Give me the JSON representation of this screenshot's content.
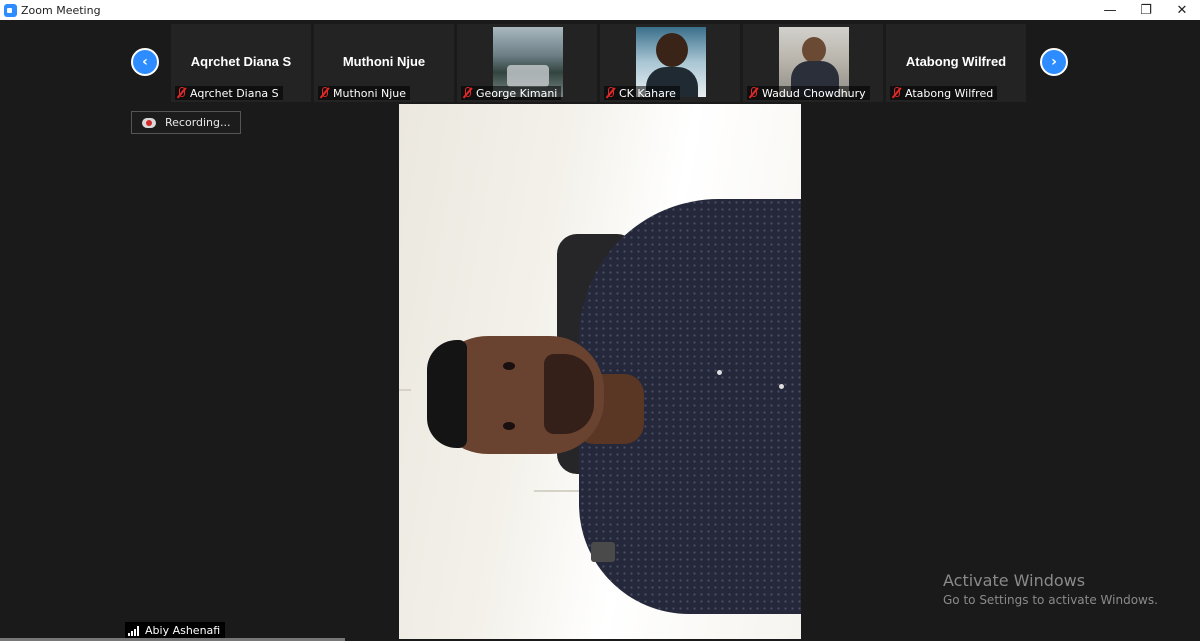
{
  "window": {
    "title": "Zoom Meeting",
    "controls": {
      "minimize": "—",
      "restore": "❐",
      "close": "✕"
    }
  },
  "strip": {
    "prev_icon": "chevron-left-icon",
    "next_icon": "chevron-right-icon",
    "participants": [
      {
        "display_name": "Aqrchet Diana S",
        "label": "Aqrchet Diana S",
        "muted": true,
        "video": false
      },
      {
        "display_name": "Muthoni Njue",
        "label": "Muthoni Njue",
        "muted": true,
        "video": false
      },
      {
        "label": "George Kimani",
        "muted": true,
        "video": true
      },
      {
        "label": "CK Kahare",
        "muted": true,
        "video": true
      },
      {
        "label": "Wadud Chowdhury",
        "muted": true,
        "video": true
      },
      {
        "display_name": "Atabong Wilfred",
        "label": "Atabong Wilfred",
        "muted": true,
        "video": false
      }
    ]
  },
  "recording": {
    "label": "Recording..."
  },
  "active_speaker": {
    "name": "Abiy Ashenafi"
  },
  "watermark": {
    "title": "Activate Windows",
    "subtitle": "Go to Settings to activate Windows."
  },
  "colors": {
    "accent": "#2d8cff",
    "muted_red": "#e02828",
    "background": "#1a1a1a"
  }
}
